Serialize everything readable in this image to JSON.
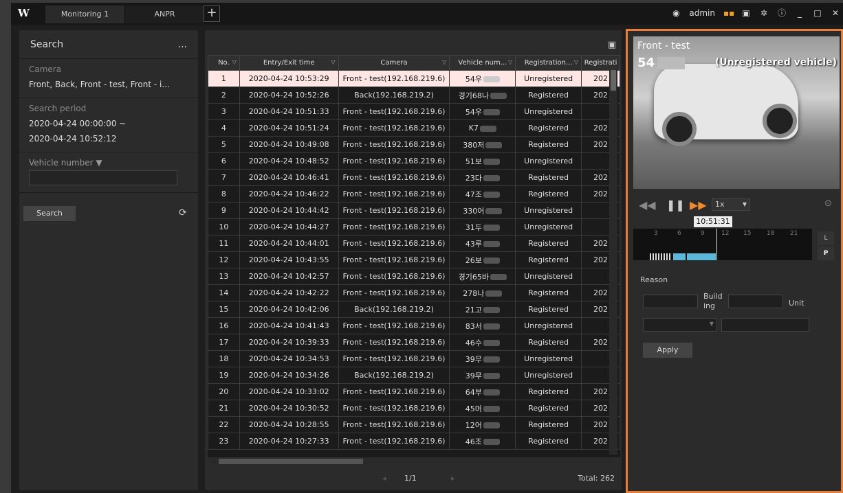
{
  "titlebar": {
    "logo": "W",
    "tabs": [
      "Monitoring 1",
      "ANPR"
    ],
    "add_tab": "+",
    "user": "admin"
  },
  "search": {
    "title": "Search",
    "more": "...",
    "camera_label": "Camera",
    "camera_value": "Front, Back, Front - test, Front - i...",
    "period_label": "Search period",
    "period_from": "2020-04-24 00:00:00 ~",
    "period_to": "2020-04-24 10:52:12",
    "vehicle_label": "Vehicle number",
    "vehicle_dropdown": "▼",
    "search_button": "Search"
  },
  "table": {
    "headers": [
      "No.",
      "Entry/Exit time",
      "Camera",
      "Vehicle num...",
      "Registration...",
      "Registrati"
    ],
    "rows": [
      [
        "1",
        "2020-04-24 10:53:29",
        "Front - test(192.168.219.6)",
        "54우",
        "Unregistered",
        "202"
      ],
      [
        "2",
        "2020-04-24 10:52:26",
        "Back(192.168.219.2)",
        "경기68나",
        "Registered",
        "202"
      ],
      [
        "3",
        "2020-04-24 10:51:33",
        "Front - test(192.168.219.6)",
        "54우",
        "Unregistered",
        ""
      ],
      [
        "4",
        "2020-04-24 10:51:24",
        "Front - test(192.168.219.6)",
        "K7",
        "Registered",
        "202"
      ],
      [
        "5",
        "2020-04-24 10:49:08",
        "Front - test(192.168.219.6)",
        "380저",
        "Registered",
        "202"
      ],
      [
        "6",
        "2020-04-24 10:48:52",
        "Front - test(192.168.219.6)",
        "51보",
        "Unregistered",
        ""
      ],
      [
        "7",
        "2020-04-24 10:46:41",
        "Front - test(192.168.219.6)",
        "23다",
        "Registered",
        "202"
      ],
      [
        "8",
        "2020-04-24 10:46:22",
        "Front - test(192.168.219.6)",
        "47조",
        "Registered",
        "202"
      ],
      [
        "9",
        "2020-04-24 10:44:42",
        "Front - test(192.168.219.6)",
        "330어",
        "Unregistered",
        ""
      ],
      [
        "10",
        "2020-04-24 10:44:27",
        "Front - test(192.168.219.6)",
        "31두",
        "Unregistered",
        ""
      ],
      [
        "11",
        "2020-04-24 10:44:01",
        "Front - test(192.168.219.6)",
        "43루",
        "Registered",
        "202"
      ],
      [
        "12",
        "2020-04-24 10:43:55",
        "Front - test(192.168.219.6)",
        "26보",
        "Registered",
        "202"
      ],
      [
        "13",
        "2020-04-24 10:42:57",
        "Front - test(192.168.219.6)",
        "경기65바",
        "Unregistered",
        ""
      ],
      [
        "14",
        "2020-04-24 10:42:22",
        "Front - test(192.168.219.6)",
        "278나",
        "Registered",
        "202"
      ],
      [
        "15",
        "2020-04-24 10:42:06",
        "Back(192.168.219.2)",
        "21고",
        "Registered",
        "202"
      ],
      [
        "16",
        "2020-04-24 10:41:43",
        "Front - test(192.168.219.6)",
        "83서",
        "Unregistered",
        ""
      ],
      [
        "17",
        "2020-04-24 10:39:33",
        "Front - test(192.168.219.6)",
        "46수",
        "Registered",
        "202"
      ],
      [
        "18",
        "2020-04-24 10:34:53",
        "Front - test(192.168.219.6)",
        "39무",
        "Unregistered",
        ""
      ],
      [
        "19",
        "2020-04-24 10:34:26",
        "Back(192.168.219.2)",
        "39무",
        "Unregistered",
        ""
      ],
      [
        "20",
        "2020-04-24 10:33:02",
        "Front - test(192.168.219.6)",
        "64부",
        "Registered",
        "202"
      ],
      [
        "21",
        "2020-04-24 10:30:52",
        "Front - test(192.168.219.6)",
        "45머",
        "Registered",
        "202"
      ],
      [
        "22",
        "2020-04-24 10:28:55",
        "Front - test(192.168.219.6)",
        "12어",
        "Registered",
        "202"
      ],
      [
        "23",
        "2020-04-24 10:27:33",
        "Front - test(192.168.219.6)",
        "46조",
        "Registered",
        "202"
      ]
    ],
    "page": "1/1",
    "total": "Total: 262"
  },
  "viewer": {
    "camera_name": "Front - test",
    "plate_prefix": "54",
    "status": "(Unregistered vehicle)",
    "speed": "1x",
    "time_tip": "10:51:31",
    "timeline_ticks": [
      "3",
      "6",
      "9",
      "12",
      "15",
      "18",
      "21"
    ],
    "mode_l": "L",
    "mode_p": "P"
  },
  "form": {
    "reason_label": "Reason",
    "building_label_1": "Build",
    "building_label_2": "ing",
    "unit_label": "Unit",
    "apply_button": "Apply"
  },
  "colors": {
    "accent": "#e87e38",
    "selected_row": "#fde6e3",
    "timeline_segment": "#5bb8d8"
  }
}
